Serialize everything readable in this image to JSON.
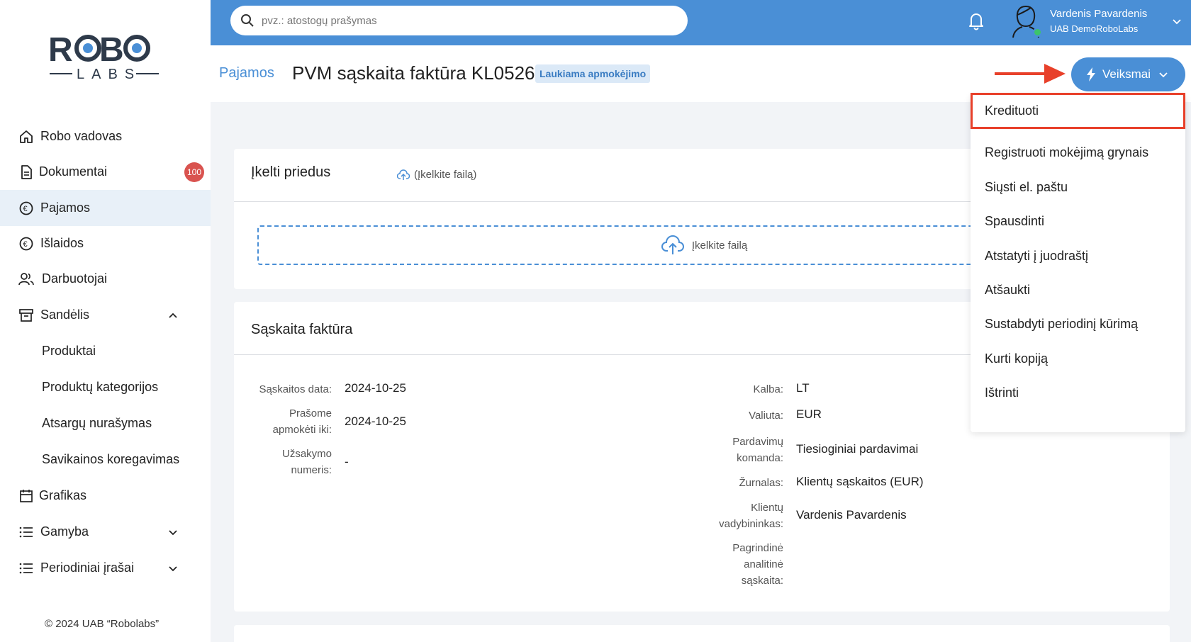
{
  "sidebar": {
    "logo_top": "ROBO",
    "logo_bottom": "LABS",
    "items": [
      {
        "label": "Robo vadovas"
      },
      {
        "label": "Dokumentai",
        "badge": "100"
      },
      {
        "label": "Pajamos"
      },
      {
        "label": "Išlaidos"
      },
      {
        "label": "Darbuotojai"
      },
      {
        "label": "Sandėlis"
      },
      {
        "label": "Produktai"
      },
      {
        "label": "Produktų kategorijos"
      },
      {
        "label": "Atsargų nurašymas"
      },
      {
        "label": "Savikainos koregavimas"
      },
      {
        "label": "Grafikas"
      },
      {
        "label": "Gamyba"
      },
      {
        "label": "Periodiniai įrašai"
      }
    ],
    "copyright": "© 2024 UAB “Robolabs”"
  },
  "topbar": {
    "search_placeholder": "pvz.: atostogų prašymas",
    "user_name": "Vardenis Pavardenis",
    "user_company": "UAB DemoRoboLabs"
  },
  "header": {
    "breadcrumb": "Pajamos",
    "title": "PVM sąskaita faktūra KL0526",
    "status": "Laukiama apmokėjimo",
    "actions_label": "Veiksmai"
  },
  "attachments": {
    "title": "Įkelti priedus",
    "upload_link": "(Įkelkite failą)",
    "dropzone": "Įkelkite failą"
  },
  "invoice": {
    "title": "Sąskaita faktūra",
    "left": [
      {
        "label": "Sąskaitos data:",
        "value": "2024-10-25"
      },
      {
        "label": "Prašome apmokėti iki:",
        "value": "2024-10-25"
      },
      {
        "label": "Užsakymo numeris:",
        "value": "-"
      }
    ],
    "right": [
      {
        "label": "Kalba:",
        "value": "LT"
      },
      {
        "label": "Valiuta:",
        "value": "EUR"
      },
      {
        "label": "Pardavimų komanda:",
        "value": "Tiesioginiai pardavimai"
      },
      {
        "label": "Žurnalas:",
        "value": "Klientų sąskaitos (EUR)"
      },
      {
        "label": "Klientų vadybininkas:",
        "value": "Vardenis Pavardenis"
      },
      {
        "label": "Pagrindinė analitinė sąskaita:",
        "value": ""
      }
    ]
  },
  "actions_menu": [
    {
      "label": "Kredituoti"
    },
    {
      "label": "Registruoti mokėjimą grynais"
    },
    {
      "label": "Siųsti el. paštu"
    },
    {
      "label": "Spausdinti"
    },
    {
      "label": "Atstatyti į juodraštį"
    },
    {
      "label": "Atšaukti"
    },
    {
      "label": "Sustabdyti periodinį kūrimą"
    },
    {
      "label": "Kurti kopiją"
    },
    {
      "label": "Ištrinti"
    }
  ],
  "colors": {
    "primary": "#4a8fd6",
    "active_nav": "#e8f0f8",
    "badge": "#d9534f",
    "highlight": "#e8402a"
  }
}
